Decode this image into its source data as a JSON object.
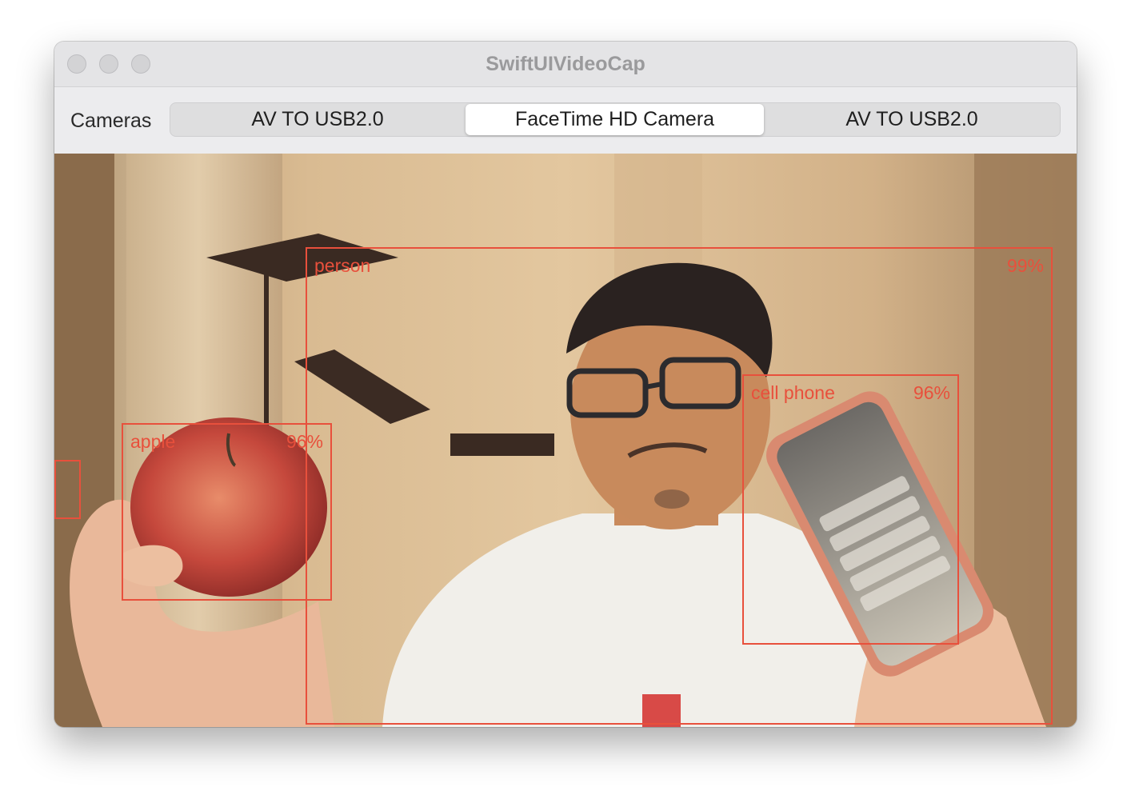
{
  "window": {
    "title": "SwiftUIVideoCap"
  },
  "toolbar": {
    "label": "Cameras",
    "segments": [
      {
        "label": "AV TO USB2.0",
        "selected": false
      },
      {
        "label": "FaceTime HD Camera",
        "selected": true
      },
      {
        "label": "AV TO USB2.0",
        "selected": false
      }
    ]
  },
  "detections": [
    {
      "label": "person",
      "confidence": "99%"
    },
    {
      "label": "cell phone",
      "confidence": "96%"
    },
    {
      "label": "apple",
      "confidence": "96%"
    },
    {
      "label": "",
      "confidence": ""
    }
  ],
  "colors": {
    "detection_box": "#e8503c",
    "selected_segment": "#ffffff"
  }
}
